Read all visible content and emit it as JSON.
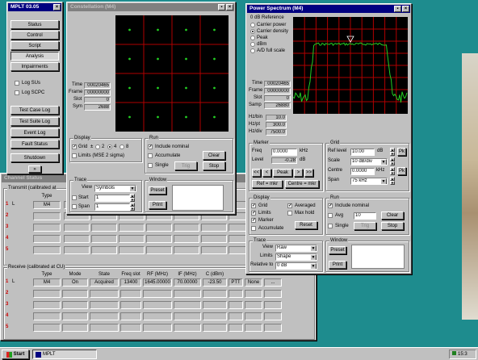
{
  "colors": {
    "desktop": "#1e8c8e",
    "title_active": "#000080",
    "trace": "#22cc22",
    "grid": "#b00000",
    "dot": "#22cc22"
  },
  "mplt": {
    "title": "MPLT 03.05",
    "buttons": [
      "Status",
      "Control",
      "Script",
      "Analysis",
      "Impairments"
    ],
    "checks": [
      {
        "label": "Log SUs",
        "checked": false
      },
      {
        "label": "Log SCPC",
        "checked": false
      }
    ],
    "bottom_buttons": [
      "Test Case Log",
      "Test Suite Log",
      "Event Log",
      "Fault Status",
      "Shutdown"
    ],
    "scroll_glyph": "»"
  },
  "constellation": {
    "title": "Constellation (M4)",
    "time_label": "Time",
    "time_value": "00020465",
    "frame_label": "Frame",
    "frame_value": "00000000",
    "slot_label": "Slot",
    "slot_value": "0",
    "sym_label": "Sym",
    "sym_value": "2688",
    "display_title": "Display",
    "grid_label": "Grid",
    "grid_pm": "±",
    "grid_opts": [
      "2",
      "4",
      "8"
    ],
    "limits_label": "Limits (MSE 2 sigma)",
    "run_title": "Run",
    "include_nominal": "Include nominal",
    "accumulate": "Accumulate",
    "single": "Single",
    "clear": "Clear",
    "trig": "Trig",
    "stop": "Stop",
    "trace_title": "Trace",
    "view_label": "View",
    "view_value": "Symbols",
    "start_label": "Start",
    "start_value": "1",
    "span_label": "Span",
    "span_value": "1",
    "window_title": "Window",
    "preset": "Preset",
    "print": "Print"
  },
  "spectrum": {
    "title": "Power Spectrum (M4)",
    "ref_title": "0 dB Reference",
    "ref_opts": [
      {
        "label": "Carrier power",
        "selected": false
      },
      {
        "label": "Carrier density",
        "selected": true
      },
      {
        "label": "Peak",
        "selected": false
      },
      {
        "label": "dBm",
        "selected": false
      },
      {
        "label": "A/D full scale",
        "selected": false
      }
    ],
    "time_label": "Time",
    "time_value": "00020465",
    "frame_label": "Frame",
    "frame_value": "00000000",
    "slot_label": "Slot",
    "slot_value": "0",
    "samp_label": "Samp",
    "samp_value": "26880",
    "hzbin_label": "Hz/bin",
    "hzbin_value": "10.0",
    "hzpt_label": "Hz/pt",
    "hzpt_value": "300.0",
    "hzdiv_label": "Hz/div",
    "hzdiv_value": "7500.0",
    "marker_title": "Marker",
    "freq_label": "Freq",
    "freq_value": "0.0000",
    "freq_unit": "kHz",
    "level_label": "Level",
    "level_value": "-0.28",
    "level_unit": "dB",
    "nav": [
      "<<",
      "<",
      "Peak",
      ">",
      ">>"
    ],
    "ref_mkr": "Ref = mkr",
    "centre_mkr": "Centre = mkr",
    "grid_title": "Grid",
    "reflevel_label": "Ref level",
    "reflevel_value": "10.00",
    "reflevel_unit": "dB",
    "scale_label": "Scale",
    "scale_value": "10 dB/div",
    "centre_label": "Centre",
    "centre_value": "0.0000",
    "centre_unit": "kHz",
    "span_label": "Span",
    "span_value": "75 kHz",
    "pk": "Pk",
    "display_title": "Display",
    "disp_checks": [
      "Grid",
      "Limits",
      "Marker",
      "Accumulate"
    ],
    "averaged": "Averaged",
    "maxhold": "Max hold",
    "reset": "Reset",
    "run_title": "Run",
    "include_nominal": "Include nominal",
    "avg_label": "Avg",
    "avg_value": "10",
    "clear": "Clear",
    "single": "Single",
    "trig": "Trig",
    "stop": "Stop",
    "trace_title": "Trace",
    "view_label": "View",
    "view_value": "Raw",
    "limits_label": "Limits",
    "limits_value": "Shape",
    "relto_label": "Relative to",
    "relto_value": "0 dB",
    "window_title": "Window",
    "preset": "Preset",
    "print": "Print"
  },
  "channel": {
    "title": "Channel Status",
    "transmit_label": "Transmit (calibrated at",
    "receive_label": "Receive (calibrated at CU)",
    "tx_type_header": "Type",
    "tx_rows": [
      {
        "num": "1",
        "mark": "L",
        "type": "M4"
      },
      {
        "num": "2",
        "mark": "",
        "type": ""
      },
      {
        "num": "3",
        "mark": "",
        "type": ""
      },
      {
        "num": "4",
        "mark": "",
        "type": ""
      },
      {
        "num": "5",
        "mark": "",
        "type": ""
      }
    ],
    "rx_headers": [
      "Type",
      "Mode",
      "State",
      "Freq slot",
      "RF (MHz)",
      "IF (MHz)",
      "C (dBm)"
    ],
    "rx_rows": [
      {
        "num": "1",
        "mark": "L",
        "cells": [
          "M4",
          "On",
          "Acquired",
          "13400",
          "1645.00000",
          "70.00000",
          "-23.50",
          "PTT",
          "None",
          "..."
        ]
      },
      {
        "num": "2",
        "mark": "",
        "cells": [
          "",
          "",
          "",
          "",
          "",
          "",
          "",
          "",
          "",
          ""
        ]
      },
      {
        "num": "3",
        "mark": "",
        "cells": [
          "",
          "",
          "",
          "",
          "",
          "",
          "",
          "",
          "",
          ""
        ]
      },
      {
        "num": "4",
        "mark": "",
        "cells": [
          "",
          "",
          "",
          "",
          "",
          "",
          "",
          "",
          "",
          ""
        ]
      },
      {
        "num": "5",
        "mark": "",
        "cells": [
          "",
          "",
          "",
          "",
          "",
          "",
          "",
          "",
          "",
          ""
        ]
      }
    ]
  },
  "taskbar": {
    "start": "Start",
    "app": "MPLT",
    "clock": "15:3"
  },
  "close_glyph": "×"
}
